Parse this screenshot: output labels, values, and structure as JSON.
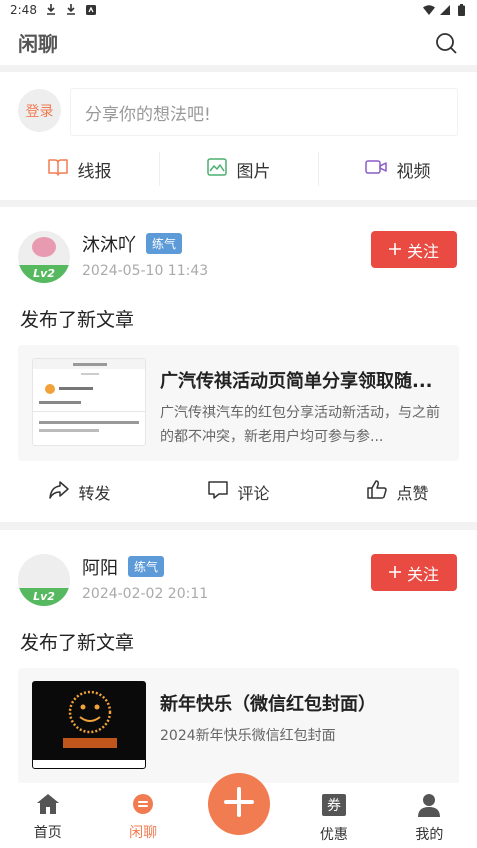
{
  "status_bar": {
    "time": "2:48"
  },
  "header": {
    "title": "闲聊"
  },
  "composer": {
    "login_label": "登录",
    "placeholder": "分享你的想法吧!",
    "actions": [
      {
        "label": "线报",
        "icon": "book-icon",
        "color": "#f27c52"
      },
      {
        "label": "图片",
        "icon": "image-icon",
        "color": "#4caf70"
      },
      {
        "label": "视频",
        "icon": "video-icon",
        "color": "#8a5cc7"
      }
    ]
  },
  "posts": [
    {
      "author": "沐沐吖",
      "rank": "练气",
      "level": "Lv2",
      "time": "2024-05-10 11:43",
      "follow_label": "关注",
      "text": "发布了新文章",
      "article": {
        "title": "广汽传祺活动页简单分享领取随...",
        "desc": "广汽传祺汽车的红包分享活动新活动，与之前的都不冲突，新老用户均可参与参..."
      },
      "actions": [
        "转发",
        "评论",
        "点赞"
      ]
    },
    {
      "author": "阿阳",
      "rank": "练气",
      "level": "Lv2",
      "time": "2024-02-02 20:11",
      "follow_label": "关注",
      "text": "发布了新文章",
      "article": {
        "title": "新年快乐（微信红包封面）",
        "desc": "2024新年快乐微信红包封面"
      }
    }
  ],
  "bottom_nav": [
    {
      "label": "首页",
      "icon": "home-icon"
    },
    {
      "label": "闲聊",
      "icon": "chat-icon",
      "active": true
    },
    {
      "label": "",
      "icon": "plus-icon"
    },
    {
      "label": "优惠",
      "icon": "coupon-icon"
    },
    {
      "label": "我的",
      "icon": "user-icon"
    }
  ],
  "colors": {
    "accent": "#f27c52",
    "follow": "#e94b43",
    "level": "#56b85f",
    "rank": "#5d9ad8"
  }
}
